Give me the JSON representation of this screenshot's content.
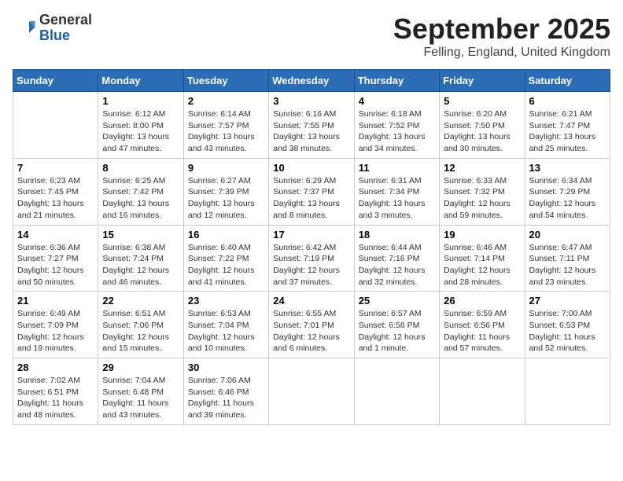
{
  "header": {
    "logo_general": "General",
    "logo_blue": "Blue",
    "month": "September 2025",
    "location": "Felling, England, United Kingdom"
  },
  "weekdays": [
    "Sunday",
    "Monday",
    "Tuesday",
    "Wednesday",
    "Thursday",
    "Friday",
    "Saturday"
  ],
  "weeks": [
    [
      {
        "day": "",
        "info": ""
      },
      {
        "day": "1",
        "info": "Sunrise: 6:12 AM\nSunset: 8:00 PM\nDaylight: 13 hours\nand 47 minutes."
      },
      {
        "day": "2",
        "info": "Sunrise: 6:14 AM\nSunset: 7:57 PM\nDaylight: 13 hours\nand 43 minutes."
      },
      {
        "day": "3",
        "info": "Sunrise: 6:16 AM\nSunset: 7:55 PM\nDaylight: 13 hours\nand 38 minutes."
      },
      {
        "day": "4",
        "info": "Sunrise: 6:18 AM\nSunset: 7:52 PM\nDaylight: 13 hours\nand 34 minutes."
      },
      {
        "day": "5",
        "info": "Sunrise: 6:20 AM\nSunset: 7:50 PM\nDaylight: 13 hours\nand 30 minutes."
      },
      {
        "day": "6",
        "info": "Sunrise: 6:21 AM\nSunset: 7:47 PM\nDaylight: 13 hours\nand 25 minutes."
      }
    ],
    [
      {
        "day": "7",
        "info": "Sunrise: 6:23 AM\nSunset: 7:45 PM\nDaylight: 13 hours\nand 21 minutes."
      },
      {
        "day": "8",
        "info": "Sunrise: 6:25 AM\nSunset: 7:42 PM\nDaylight: 13 hours\nand 16 minutes."
      },
      {
        "day": "9",
        "info": "Sunrise: 6:27 AM\nSunset: 7:39 PM\nDaylight: 13 hours\nand 12 minutes."
      },
      {
        "day": "10",
        "info": "Sunrise: 6:29 AM\nSunset: 7:37 PM\nDaylight: 13 hours\nand 8 minutes."
      },
      {
        "day": "11",
        "info": "Sunrise: 6:31 AM\nSunset: 7:34 PM\nDaylight: 13 hours\nand 3 minutes."
      },
      {
        "day": "12",
        "info": "Sunrise: 6:33 AM\nSunset: 7:32 PM\nDaylight: 12 hours\nand 59 minutes."
      },
      {
        "day": "13",
        "info": "Sunrise: 6:34 AM\nSunset: 7:29 PM\nDaylight: 12 hours\nand 54 minutes."
      }
    ],
    [
      {
        "day": "14",
        "info": "Sunrise: 6:36 AM\nSunset: 7:27 PM\nDaylight: 12 hours\nand 50 minutes."
      },
      {
        "day": "15",
        "info": "Sunrise: 6:38 AM\nSunset: 7:24 PM\nDaylight: 12 hours\nand 46 minutes."
      },
      {
        "day": "16",
        "info": "Sunrise: 6:40 AM\nSunset: 7:22 PM\nDaylight: 12 hours\nand 41 minutes."
      },
      {
        "day": "17",
        "info": "Sunrise: 6:42 AM\nSunset: 7:19 PM\nDaylight: 12 hours\nand 37 minutes."
      },
      {
        "day": "18",
        "info": "Sunrise: 6:44 AM\nSunset: 7:16 PM\nDaylight: 12 hours\nand 32 minutes."
      },
      {
        "day": "19",
        "info": "Sunrise: 6:46 AM\nSunset: 7:14 PM\nDaylight: 12 hours\nand 28 minutes."
      },
      {
        "day": "20",
        "info": "Sunrise: 6:47 AM\nSunset: 7:11 PM\nDaylight: 12 hours\nand 23 minutes."
      }
    ],
    [
      {
        "day": "21",
        "info": "Sunrise: 6:49 AM\nSunset: 7:09 PM\nDaylight: 12 hours\nand 19 minutes."
      },
      {
        "day": "22",
        "info": "Sunrise: 6:51 AM\nSunset: 7:06 PM\nDaylight: 12 hours\nand 15 minutes."
      },
      {
        "day": "23",
        "info": "Sunrise: 6:53 AM\nSunset: 7:04 PM\nDaylight: 12 hours\nand 10 minutes."
      },
      {
        "day": "24",
        "info": "Sunrise: 6:55 AM\nSunset: 7:01 PM\nDaylight: 12 hours\nand 6 minutes."
      },
      {
        "day": "25",
        "info": "Sunrise: 6:57 AM\nSunset: 6:58 PM\nDaylight: 12 hours\nand 1 minute."
      },
      {
        "day": "26",
        "info": "Sunrise: 6:59 AM\nSunset: 6:56 PM\nDaylight: 11 hours\nand 57 minutes."
      },
      {
        "day": "27",
        "info": "Sunrise: 7:00 AM\nSunset: 6:53 PM\nDaylight: 11 hours\nand 52 minutes."
      }
    ],
    [
      {
        "day": "28",
        "info": "Sunrise: 7:02 AM\nSunset: 6:51 PM\nDaylight: 11 hours\nand 48 minutes."
      },
      {
        "day": "29",
        "info": "Sunrise: 7:04 AM\nSunset: 6:48 PM\nDaylight: 11 hours\nand 43 minutes."
      },
      {
        "day": "30",
        "info": "Sunrise: 7:06 AM\nSunset: 6:46 PM\nDaylight: 11 hours\nand 39 minutes."
      },
      {
        "day": "",
        "info": ""
      },
      {
        "day": "",
        "info": ""
      },
      {
        "day": "",
        "info": ""
      },
      {
        "day": "",
        "info": ""
      }
    ]
  ]
}
